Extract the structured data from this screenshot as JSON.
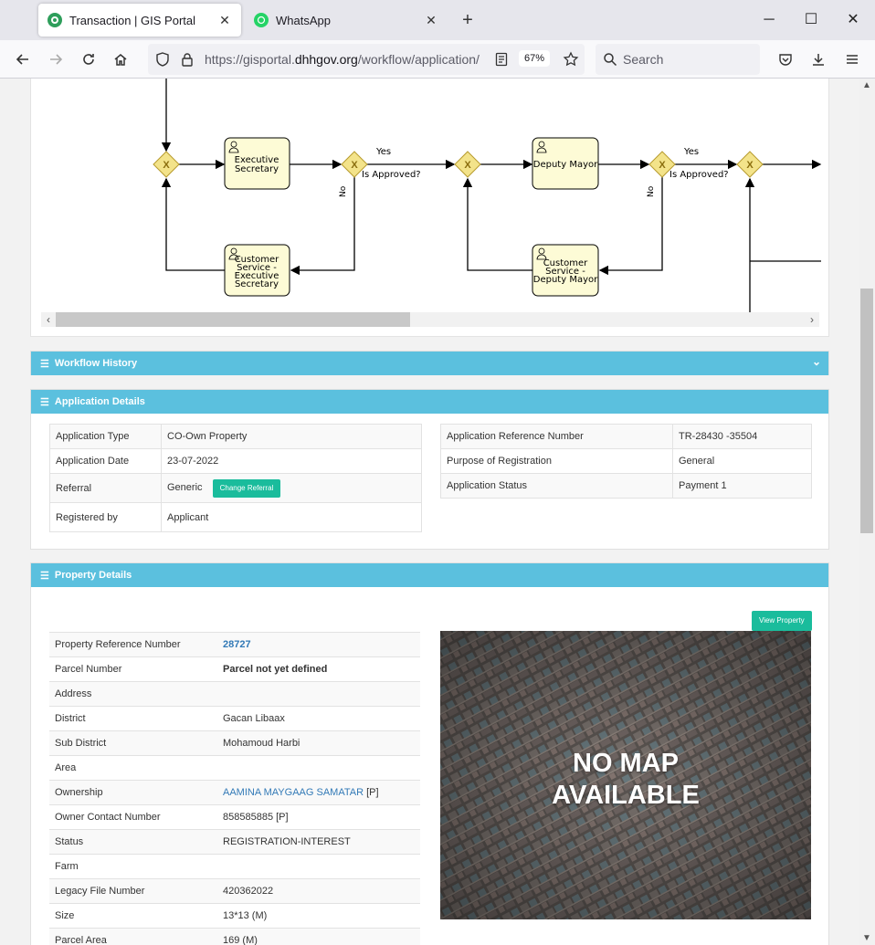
{
  "browser": {
    "tabs": [
      {
        "title": "Transaction | GIS Portal",
        "active": true
      },
      {
        "title": "WhatsApp",
        "active": false
      }
    ],
    "url_prefix": "https://gisportal.",
    "url_domain": "dhhgov.org",
    "url_path": "/workflow/application/",
    "zoom": "67%",
    "search_placeholder": "Search"
  },
  "diagram": {
    "tasks": {
      "exec_sec": [
        "Executive",
        "Secretary"
      ],
      "cs_exec": [
        "Customer",
        "Service -",
        "Executive",
        "Secretary"
      ],
      "deputy": [
        "Deputy Mayor"
      ],
      "cs_deputy": [
        "Customer",
        "Service -",
        "Deputy Mayor"
      ]
    },
    "yes": "Yes",
    "no": "No",
    "approved_q": "Is Approved?"
  },
  "workflow_history": {
    "title": "Workflow History"
  },
  "application_details": {
    "title": "Application Details",
    "left": [
      {
        "label": "Application Type",
        "value": "CO-Own Property"
      },
      {
        "label": "Application Date",
        "value": "23-07-2022"
      },
      {
        "label": "Referral",
        "value": "Generic"
      },
      {
        "label": "Registered by",
        "value": "Applicant"
      }
    ],
    "change_referral_label": "Change Referral",
    "right": [
      {
        "label": "Application Reference Number",
        "value": "TR-28430 -35504"
      },
      {
        "label": "Purpose of Registration",
        "value": "General"
      },
      {
        "label": "Application Status",
        "value": "Payment 1"
      }
    ]
  },
  "property_details": {
    "title": "Property Details",
    "view_property_label": "View Property",
    "rows": [
      {
        "label": "Property Reference Number",
        "value": "28727"
      },
      {
        "label": "Parcel Number",
        "value": "Parcel not yet defined"
      },
      {
        "label": "Address",
        "value": ""
      },
      {
        "label": "District",
        "value": "Gacan Libaax"
      },
      {
        "label": "Sub District",
        "value": "Mohamoud Harbi"
      },
      {
        "label": "Area",
        "value": ""
      },
      {
        "label": "Ownership",
        "value": "AAMINA MAYGAAG SAMATAR",
        "suffix": " [P]"
      },
      {
        "label": "Owner Contact Number",
        "value": "858585885 [P]"
      },
      {
        "label": "Status",
        "value": "REGISTRATION-INTEREST"
      },
      {
        "label": "Farm",
        "value": ""
      },
      {
        "label": "Legacy File Number",
        "value": "420362022"
      },
      {
        "label": "Size",
        "value": "13*13 (M)"
      },
      {
        "label": "Parcel Area",
        "value": "169 (M)"
      }
    ],
    "map_text": [
      "NO MAP",
      "AVAILABLE"
    ]
  }
}
